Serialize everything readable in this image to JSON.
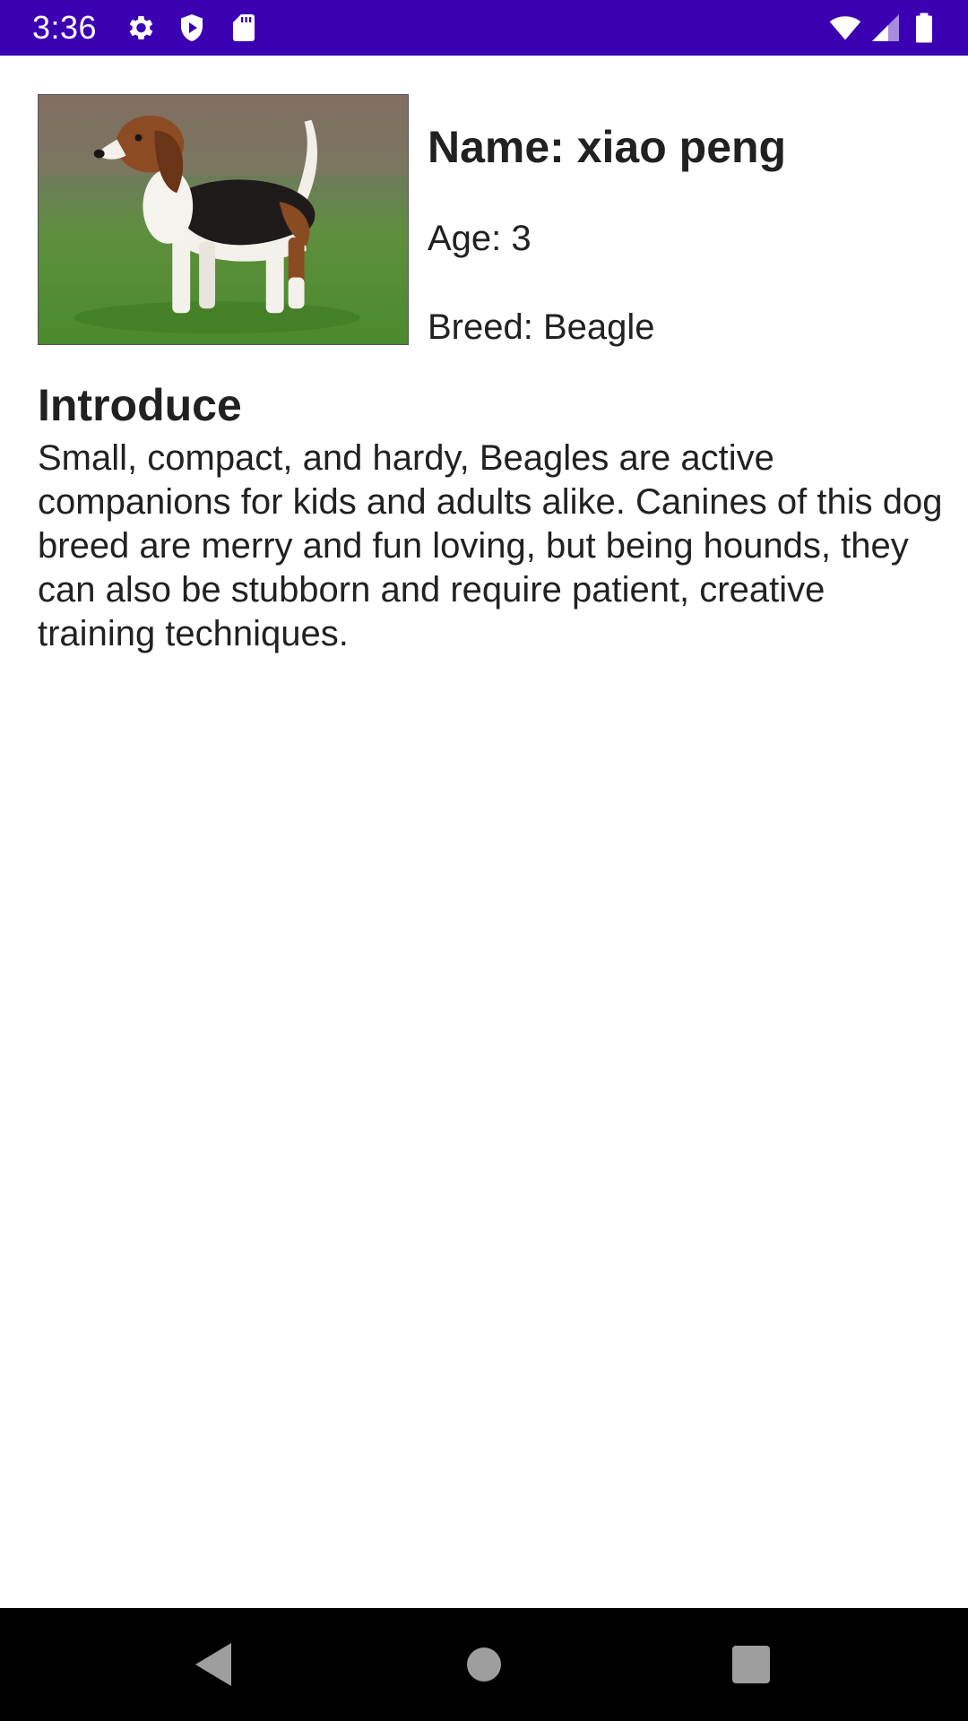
{
  "status_bar": {
    "time": "3:36",
    "background_color": "#3c00b3",
    "left_icons": [
      "gear-icon",
      "shield-play-icon",
      "sd-card-icon"
    ],
    "right_icons": [
      "wifi-icon",
      "cell-signal-icon",
      "battery-icon"
    ]
  },
  "dog": {
    "photo_icon": "beagle-photo",
    "name": "Name: xiao peng",
    "age": "Age: 3",
    "breed": "Breed: Beagle"
  },
  "introduce": {
    "heading": "Introduce",
    "body": "Small, compact, and hardy, Beagles are active companions for kids and adults alike. Canines of this dog breed are merry and fun loving, but being hounds, they can also be stubborn and require patient, creative training techniques."
  },
  "nav_bar": {
    "buttons": [
      "back-icon",
      "home-icon",
      "recents-icon"
    ]
  }
}
